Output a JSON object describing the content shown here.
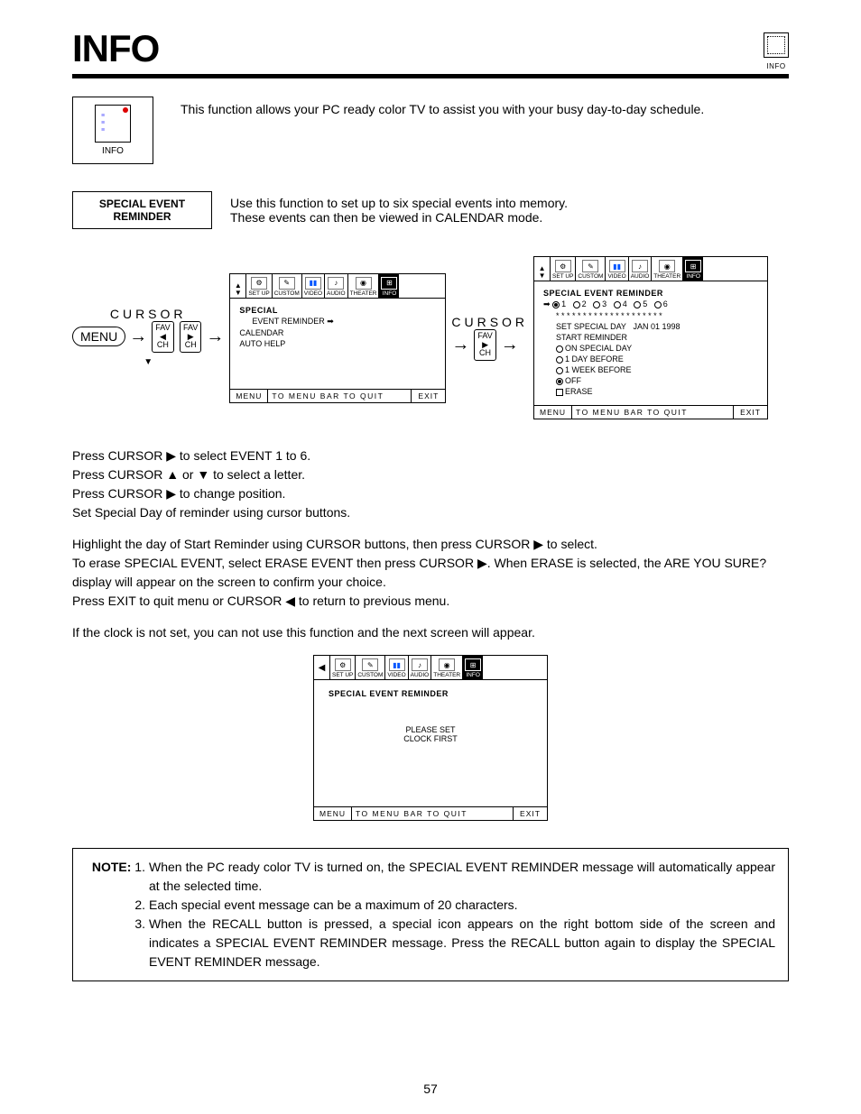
{
  "page": {
    "title": "INFO",
    "top_icon_label": "INFO",
    "page_number": "57"
  },
  "intro": {
    "badge_label": "INFO",
    "text": "This function allows your PC ready color TV to assist you with your busy day-to-day schedule."
  },
  "ser": {
    "box_line1": "SPECIAL EVENT",
    "box_line2": "REMINDER",
    "text_line1": "Use this function to set up to six special events into memory.",
    "text_line2": "These events can then be viewed in CALENDAR mode."
  },
  "diagram": {
    "cursor_label": "CURSOR",
    "menu_label": "MENU",
    "fav_left": "FAV\n◀\nCH",
    "fav_right": "FAV\n▶\nCH",
    "menubar_tabs": [
      "SET UP",
      "CUSTOM",
      "VIDEO",
      "AUDIO",
      "THEATER",
      "INFO"
    ],
    "screen1": {
      "title": "SPECIAL",
      "line1": "EVENT REMINDER",
      "line2": "CALENDAR",
      "line3": "AUTO HELP"
    },
    "screen2": {
      "title": "SPECIAL EVENT REMINDER",
      "events": [
        "1",
        "2",
        "3",
        "4",
        "5",
        "6"
      ],
      "stars": "* * * * * * * * * * * * * * * * * * * *",
      "set_day_label": "SET SPECIAL DAY",
      "set_day_value": "JAN 01 1998",
      "start_reminder": "START REMINDER",
      "opts": [
        "ON SPECIAL DAY",
        "1 DAY BEFORE",
        "1 WEEK BEFORE",
        "OFF",
        "ERASE"
      ],
      "opt_selected_index": 3
    },
    "foot": {
      "c1": "MENU",
      "c2": "TO MENU BAR    TO QUIT",
      "c3": "EXIT"
    }
  },
  "instructions1": {
    "l1": "Press CURSOR ▶ to select EVENT 1 to 6.",
    "l2": "Press CURSOR ▲ or ▼ to select a letter.",
    "l3": "Press CURSOR ▶ to change position.",
    "l4": "Set Special Day of reminder using cursor buttons."
  },
  "instructions2": {
    "l1": "Highlight the day of Start Reminder using CURSOR buttons, then press CURSOR ▶ to select.",
    "l2": "To erase SPECIAL EVENT, select ERASE EVENT then press CURSOR ▶. When ERASE is selected, the  ARE YOU SURE? display will appear on the screen to confirm your choice.",
    "l3": "Press EXIT to quit menu or CURSOR ◀ to return to previous menu."
  },
  "instructions3": {
    "l1": "If the clock is not set, you can not use this function and the next screen will appear."
  },
  "center_screen": {
    "title": "SPECIAL EVENT REMINDER",
    "msg1": "PLEASE SET",
    "msg2": "CLOCK FIRST"
  },
  "note": {
    "label": "NOTE:",
    "n1": "When the PC ready color TV is turned on, the SPECIAL EVENT REMINDER message will automatically appear at the selected time.",
    "n2": "Each special event message can be a maximum of 20 characters.",
    "n3": "When the RECALL button is pressed, a special icon appears on the right bottom side of the screen and indicates a SPECIAL EVENT REMINDER message. Press the RECALL button again to display the SPECIAL EVENT REMINDER message."
  }
}
